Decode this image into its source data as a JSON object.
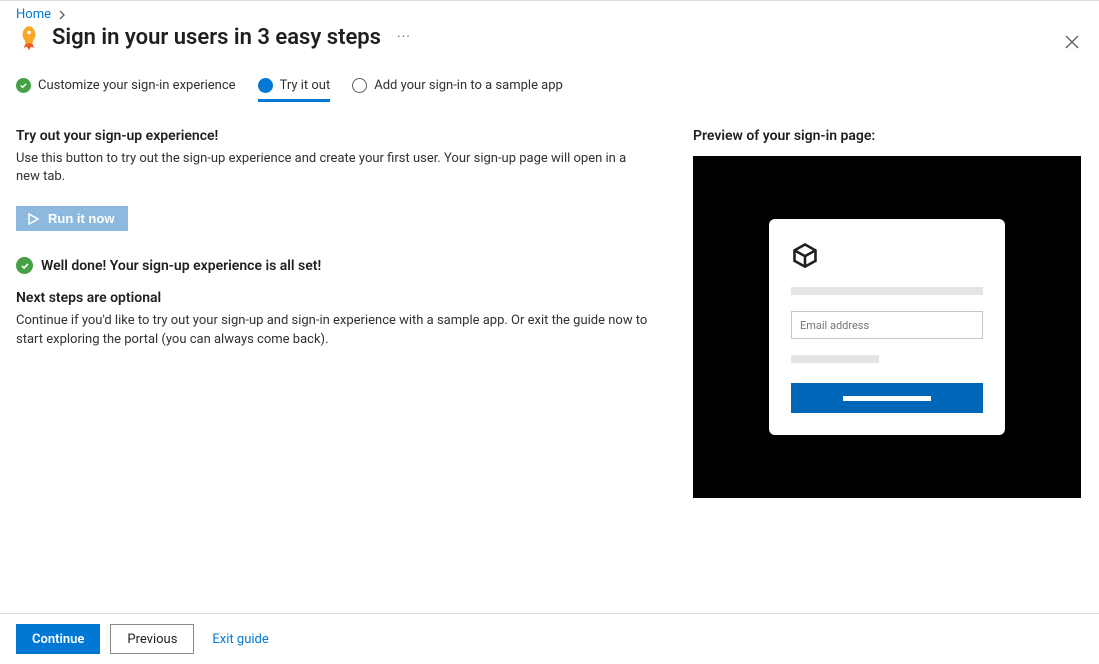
{
  "breadcrumb": {
    "home": "Home"
  },
  "title": "Sign in your users in 3 easy steps",
  "steps": [
    {
      "label": "Customize your sign-in experience",
      "state": "done"
    },
    {
      "label": "Try it out",
      "state": "current"
    },
    {
      "label": "Add your sign-in to a sample app",
      "state": "pending"
    }
  ],
  "left": {
    "heading1": "Try out your sign-up experience!",
    "para1": "Use this button to try out the sign-up experience and create your first user. Your sign-up page will open in a new tab.",
    "run_label": "Run it now",
    "status": "Well done! Your sign-up experience is all set!",
    "heading2": "Next steps are optional",
    "para2": "Continue if you'd like to try out your sign-up and sign-in experience with a sample app. Or exit the guide now to start exploring the portal (you can always come back)."
  },
  "preview": {
    "label": "Preview of your sign-in page:",
    "email_placeholder": "Email address"
  },
  "footer": {
    "continue": "Continue",
    "previous": "Previous",
    "exit": "Exit guide"
  }
}
